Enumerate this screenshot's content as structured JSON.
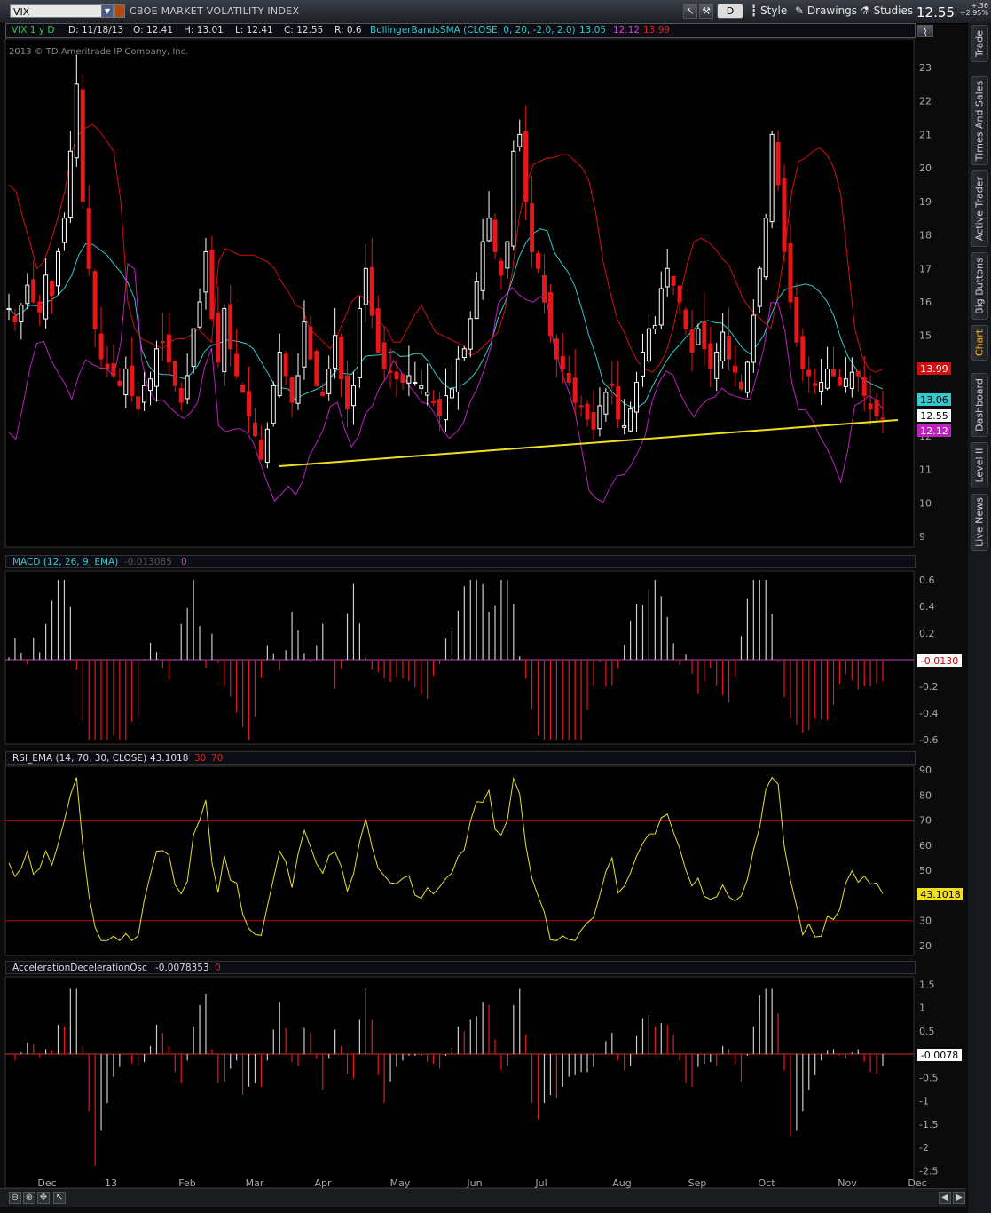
{
  "toolbar": {
    "symbol": "VIX",
    "symbol_name": "CBOE MARKET VOLATILITY INDEX",
    "aggregation": "D",
    "style_label": "Style",
    "drawings_label": "Drawings",
    "studies_label": "Studies",
    "last_price": "12.55",
    "change_abs": "+.36",
    "change_pct": "+2.95%"
  },
  "header": {
    "period": "VIX 1 y D",
    "date": "D: 11/18/13",
    "open": "O: 12.41",
    "high": "H: 13.01",
    "low": "L: 12.41",
    "close": "C: 12.55",
    "range": "R: 0.6",
    "study": "BollingerBandsSMA (CLOSE, 0, 20, -2.0, 2.0)",
    "bb_mid": "13.05",
    "bb_lower": "12.12",
    "bb_upper": "13.99",
    "copyright": "2013 © TD Ameritrade IP Company, Inc."
  },
  "colors": {
    "up": "#ffffff",
    "down": "#e8171a",
    "bb_upper": "#d01010",
    "bb_mid": "#36c8c8",
    "bb_lower": "#c020c0",
    "trendline": "#f0e020",
    "rsi": "#e8e030",
    "grid_line": "#c00000"
  },
  "price_axis": {
    "ticks": [
      "23",
      "22",
      "21",
      "20",
      "19",
      "18",
      "17",
      "16",
      "15",
      "14",
      "13",
      "12",
      "11",
      "10",
      "9"
    ],
    "badges": {
      "upper": "13.99",
      "mid": "13.06",
      "last": "12.55",
      "lower": "12.12"
    }
  },
  "x_axis": {
    "labels": [
      "Dec",
      "13",
      "Feb",
      "Mar",
      "Apr",
      "May",
      "Jun",
      "Jul",
      "Aug",
      "Sep",
      "Oct",
      "Nov",
      "Dec"
    ]
  },
  "macd": {
    "label": "MACD (12, 26, 9, EMA)",
    "value": "-0.013085",
    "zero": "0",
    "ticks": [
      "0.6",
      "0.4",
      "0.2",
      "0",
      "-0.2",
      "-0.4",
      "-0.6"
    ],
    "badge": "-0.0130"
  },
  "rsi": {
    "label": "RSI_EMA (14, 70, 30, CLOSE)",
    "value": "43.1018",
    "ob": "30",
    "os": "70",
    "ticks": [
      "90",
      "80",
      "70",
      "60",
      "50",
      "40",
      "30",
      "20"
    ],
    "badge": "43.1018"
  },
  "ac": {
    "label": "AccelerationDecelerationOsc",
    "value": "-0.0078353",
    "zero": "0",
    "ticks": [
      "1.5",
      "1",
      "0.5",
      "0",
      "-0.5",
      "-1",
      "-1.5",
      "-2",
      "-2.5"
    ],
    "badge": "-0.0078"
  },
  "side_tabs": [
    "Trade",
    "Times And Sales",
    "Active Trader",
    "Big Buttons",
    "Chart",
    "Dashboard",
    "Level II",
    "Live News"
  ],
  "chart_data": {
    "type": "candlestick",
    "title": "CBOE MARKET VOLATILITY INDEX",
    "months": [
      "Dec",
      "13",
      "Feb",
      "Mar",
      "Apr",
      "May",
      "Jun",
      "Jul",
      "Aug",
      "Sep",
      "Oct",
      "Nov",
      "Dec"
    ],
    "ylim": [
      9,
      23.5
    ],
    "close_path": [
      15.8,
      15.4,
      15.9,
      16.5,
      16.0,
      15.7,
      16.8,
      16.2,
      17.5,
      18.5,
      20.5,
      22.5,
      19.0,
      17.0,
      15.2,
      14.3,
      14.0,
      13.8,
      13.5,
      14.0,
      13.2,
      12.8,
      13.5,
      13.7,
      14.6,
      14.8,
      14.2,
      13.5,
      13.0,
      13.8,
      15.2,
      16.0,
      17.5,
      15.5,
      14.2,
      15.8,
      14.6,
      13.8,
      13.3,
      12.6,
      12.0,
      11.3,
      12.2,
      13.5,
      14.5,
      13.8,
      13.0,
      13.8,
      15.4,
      14.3,
      13.5,
      13.2,
      14.0,
      15.0,
      13.7,
      12.8,
      13.5,
      15.8,
      17.0,
      15.6,
      14.5,
      14.0,
      13.9,
      13.7,
      13.6,
      13.8,
      13.6,
      13.5,
      13.3,
      13.0,
      12.6,
      13.2,
      13.4,
      14.3,
      14.6,
      15.5,
      16.6,
      17.8,
      18.5,
      17.5,
      16.8,
      17.8,
      20.5,
      21.0,
      19.0,
      17.5,
      17.0,
      16.0,
      15.0,
      14.3,
      14.0,
      13.6,
      13.0,
      12.9,
      12.5,
      12.2,
      12.9,
      13.3,
      13.5,
      12.5,
      12.3,
      12.8,
      13.6,
      14.5,
      15.2,
      15.3,
      16.4,
      17.0,
      16.5,
      16.0,
      15.2,
      14.5,
      15.2,
      14.6,
      14.0,
      14.5,
      15.1,
      14.3,
      13.9,
      13.4,
      14.2,
      15.6,
      17.0,
      18.5,
      21.0,
      19.5,
      17.5,
      16.0,
      14.8,
      14.0,
      13.8,
      13.5,
      13.6,
      14.0,
      13.8,
      13.5,
      13.7,
      13.9,
      13.8,
      13.2,
      12.8,
      12.6,
      12.5
    ],
    "bb_upper_path": [
      19.5,
      19.3,
      18.5,
      17.8,
      17.0,
      17.2,
      17.8,
      18.5,
      19.3,
      20.5,
      21.0,
      21.2,
      21.3,
      21.1,
      20.8,
      20.5,
      19.0,
      16.0,
      15.2,
      14.9,
      14.8,
      14.7,
      14.6,
      14.8,
      14.9,
      14.9,
      15.0,
      15.2,
      15.0,
      14.8,
      17.2,
      17.6,
      17.5,
      17.4,
      17.4,
      17.4,
      17.3,
      17.2,
      17.0,
      16.6,
      16.3,
      15.9,
      15.8,
      15.2,
      15.0,
      14.8,
      14.6,
      15.0,
      15.5,
      16.0,
      16.2,
      16.1,
      15.9,
      15.4,
      15.2,
      14.8,
      14.8,
      15.2,
      15.6,
      15.9,
      15.5,
      15.1,
      15.0,
      14.9,
      14.8,
      14.7,
      14.4,
      14.5,
      14.7,
      14.9,
      15.1,
      15.8,
      16.9,
      18.5,
      19.5,
      20.1,
      20.2,
      20.3,
      20.3,
      20.4,
      20.4,
      20.2,
      20.0,
      19.6,
      18.6,
      17.2,
      16.3,
      15.5,
      15.1,
      14.6,
      14.2,
      14.0,
      13.9,
      14.1,
      14.5,
      15.2,
      16.2,
      17.1,
      17.8,
      17.9,
      17.8,
      17.6,
      17.3,
      17.1,
      16.6,
      16.1,
      15.8,
      15.6,
      15.4,
      15.2,
      16.2,
      17.6,
      19.3,
      20.2,
      20.3,
      20.5,
      20.6,
      20.4,
      20.0,
      19.2,
      17.2,
      15.2,
      14.4,
      14.0,
      13.9,
      14.0
    ]
  }
}
